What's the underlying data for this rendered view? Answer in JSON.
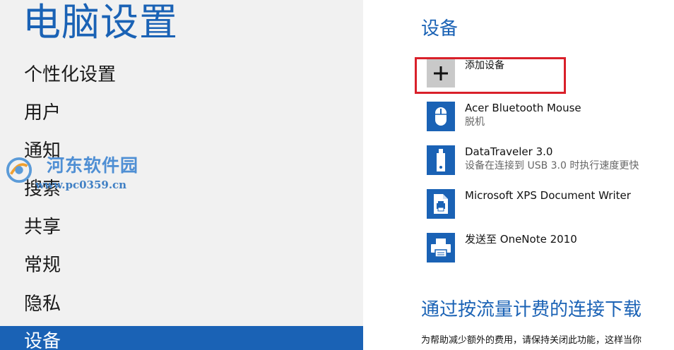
{
  "nav": {
    "title": "电脑设置",
    "items": [
      {
        "label": "个性化设置"
      },
      {
        "label": "用户"
      },
      {
        "label": "通知"
      },
      {
        "label": "搜索"
      },
      {
        "label": "共享"
      },
      {
        "label": "常规"
      },
      {
        "label": "隐私"
      },
      {
        "label": "设备"
      }
    ],
    "selected": "设备"
  },
  "watermark": {
    "name": "河东软件园",
    "url": "www.pc0359.cn"
  },
  "content": {
    "section_title": "设备",
    "add_device": {
      "label": "添加设备",
      "icon": "plus-icon"
    },
    "devices": [
      {
        "name": "Acer Bluetooth Mouse",
        "status": "脱机",
        "icon": "mouse-icon"
      },
      {
        "name": "DataTraveler 3.0",
        "status": "设备在连接到 USB 3.0 时执行速度更快",
        "icon": "usb-drive-icon"
      },
      {
        "name": "Microsoft XPS Document Writer",
        "status": "",
        "icon": "document-printer-icon"
      },
      {
        "name": "发送至 OneNote 2010",
        "status": "",
        "icon": "printer-icon"
      }
    ],
    "metered_title": "通过按流量计费的连接下载",
    "metered_desc": "为帮助减少额外的费用，请保持关闭此功能，这样当你"
  },
  "colors": {
    "accent": "#1a62b5",
    "nav_bg": "#f1f1f1",
    "highlight": "#d9202a",
    "add_icon_bg": "#c9c9c9"
  }
}
